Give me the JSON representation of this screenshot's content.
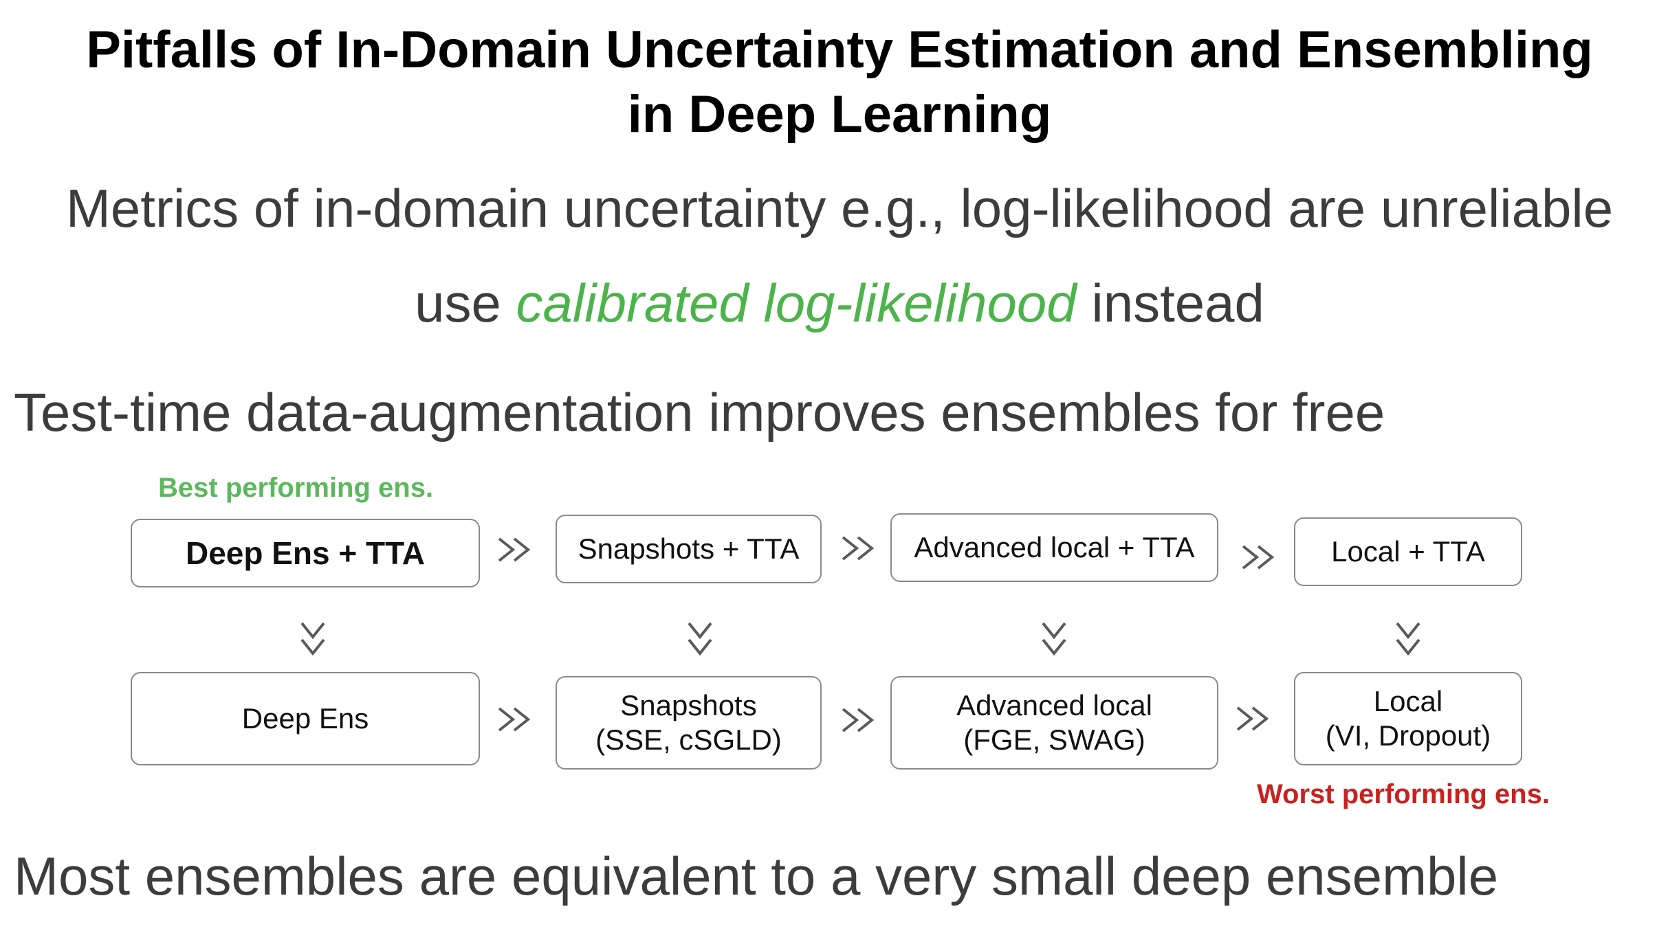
{
  "title": {
    "line1": "Pitfalls of In-Domain Uncertainty Estimation and Ensembling",
    "line2": "in Deep Learning"
  },
  "statements": {
    "metrics": "Metrics of in-domain uncertainty e.g., log-likelihood are unreliable",
    "calibrated_prefix": "use ",
    "calibrated_highlight": "calibrated log-likelihood",
    "calibrated_suffix": " instead",
    "tta": "Test-time data-augmentation improves ensembles for free",
    "small_deep": "Most ensembles are equivalent to a very small deep ensemble"
  },
  "colors": {
    "highlight_green": "#4db34b",
    "best_green": "#5cb85c",
    "worst_red": "#c9211e",
    "box_border": "#8a8a8a",
    "arrow": "#5a5a5a"
  },
  "diagram": {
    "best_label": "Best performing ens.",
    "worst_label": "Worst performing ens.",
    "tta_row": [
      {
        "line1": "Deep Ens + TTA"
      },
      {
        "line1": "Snapshots + TTA"
      },
      {
        "line1": "Advanced local + TTA"
      },
      {
        "line1": "Local + TTA"
      }
    ],
    "base_row": [
      {
        "line1": "Deep Ens"
      },
      {
        "line1": "Snapshots",
        "line2": "(SSE, cSGLD)"
      },
      {
        "line1": "Advanced local",
        "line2": "(FGE, SWAG)"
      },
      {
        "line1": "Local",
        "line2": "(VI, Dropout)"
      }
    ],
    "arrow_icon": "double-chevron-right-icon",
    "down_arrow_icon": "double-chevron-down-icon"
  }
}
